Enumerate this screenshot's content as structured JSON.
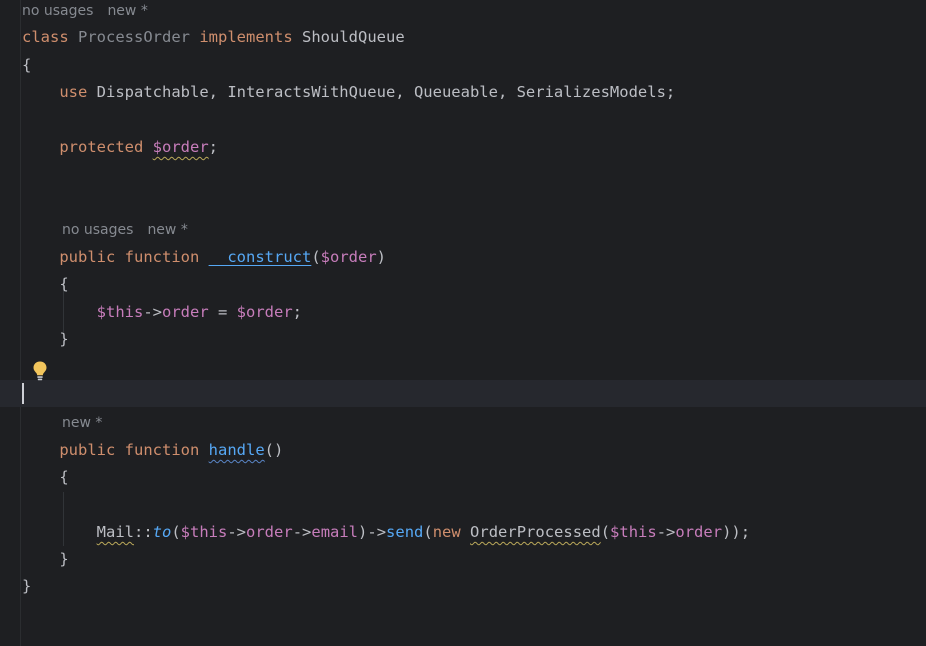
{
  "editor": {
    "hints": {
      "class_usages": "no usages",
      "class_new": "new *",
      "ctor_usages": "no usages",
      "ctor_new": "new *",
      "handle_new": "new *"
    },
    "code": {
      "kw_class": "class",
      "class_name": "ProcessOrder",
      "kw_implements": "implements",
      "interface_name": "ShouldQueue",
      "open_brace": "{",
      "kw_use": "use",
      "traits": "Dispatchable, InteractsWithQueue, Queueable, SerializesModels;",
      "kw_protected": "protected",
      "prop_order": "$order",
      "semicolon": ";",
      "kw_public": "public",
      "kw_function": "function",
      "ctor_name": "__construct",
      "ctor_paren_open": "(",
      "ctor_param": "$order",
      "ctor_paren_close": ")",
      "ctor_open": "{",
      "assign_this": "$this",
      "assign_arrow": "->",
      "assign_prop": "order",
      "assign_eq": " = ",
      "assign_val": "$order",
      "assign_semi": ";",
      "ctor_close": "}",
      "handle_name": "handle",
      "handle_parens": "()",
      "handle_open": "{",
      "mail_class": "Mail",
      "mail_colons": "::",
      "mail_to": "to",
      "p1": "(",
      "this1": "$this",
      "arrow1": "->",
      "order1": "order",
      "arrow2": "->",
      "email": "email",
      "p2": ")->",
      "send": "send",
      "p3": "(",
      "kw_new": "new",
      "order_processed": "OrderProcessed",
      "p4": "(",
      "this2": "$this",
      "arrow3": "->",
      "order2": "order",
      "p5": "));",
      "handle_close": "}",
      "class_close": "}"
    },
    "colors": {
      "background": "#1e1f22",
      "keyword": "#cf8e6d",
      "variable": "#c77dbb",
      "function": "#56a8f5",
      "text": "#bcbec4",
      "hint": "#868a91",
      "bulb": "#f2c55c"
    },
    "icons": {
      "intention": "lightbulb-icon"
    }
  }
}
